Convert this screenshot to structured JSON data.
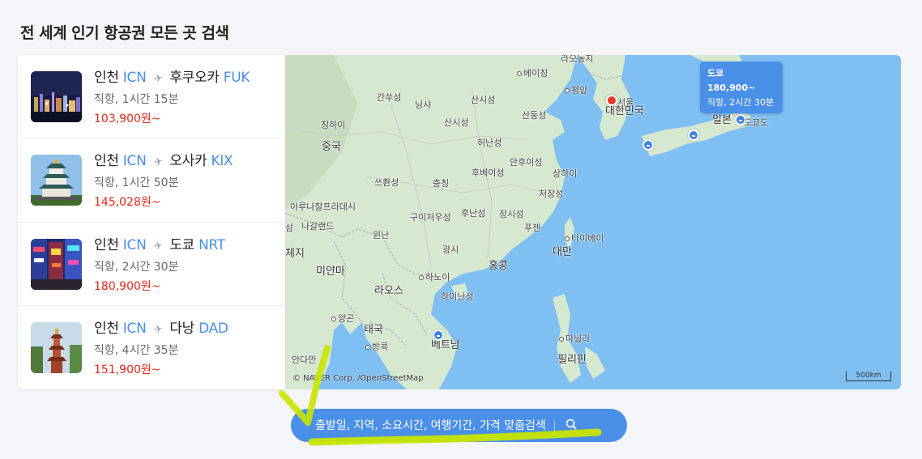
{
  "page_title": "전 세계 인기 항공권 모든 곳 검색",
  "flights": [
    {
      "origin": "인천",
      "origin_code": "ICN",
      "dest": "후쿠오카",
      "dest_code": "FUK",
      "meta": "직항, 1시간 15분",
      "price": "103,900원~",
      "thumb": "night-city"
    },
    {
      "origin": "인천",
      "origin_code": "ICN",
      "dest": "오사카",
      "dest_code": "KIX",
      "meta": "직항, 1시간 50분",
      "price": "145,028원~",
      "thumb": "castle"
    },
    {
      "origin": "인천",
      "origin_code": "ICN",
      "dest": "도쿄",
      "dest_code": "NRT",
      "meta": "직항, 2시간 30분",
      "price": "180,900원~",
      "thumb": "neon-street"
    },
    {
      "origin": "인천",
      "origin_code": "ICN",
      "dest": "다낭",
      "dest_code": "DAD",
      "meta": "직항, 4시간 35분",
      "price": "151,900원~",
      "thumb": "pagoda"
    }
  ],
  "map": {
    "tooltip": {
      "city": "도쿄",
      "price": "180,900~",
      "meta": "직항, 2시간 30분"
    },
    "labels": {
      "vladivostok": "라오동지",
      "beijing": "베이징",
      "pyongyang": "평양",
      "seoul": "서울",
      "korea": "대한민국",
      "japan": "일본",
      "tokyo": "도쿄도",
      "gansu": "간쑤성",
      "ningxia": "닝샤",
      "shanxi": "산시성",
      "shandong": "산둥성",
      "qinghai": "칭하이",
      "shaanxi": "산시성",
      "henan": "허난성",
      "china": "중국",
      "anhui": "안후이성",
      "hubei": "후베이성",
      "sichuan": "쓰촨성",
      "chongqing": "충칭",
      "shanghai": "상하이",
      "zhejiang": "저장성",
      "arunachal": "아루나찰프라데시",
      "nagaland": "나갈랜드",
      "guizhou": "구이저우성",
      "hunan": "후난성",
      "jiangxi": "장시성",
      "fujian": "푸젠",
      "taipei": "타이베이",
      "taiwan": "대만",
      "yunnan": "윈난",
      "guangxi": "광시",
      "hongkong": "홍콩",
      "myanmar": "미얀마",
      "hanoi": "하노이",
      "hainan": "하이난성",
      "laos": "라오스",
      "yangon": "양곤",
      "thailand": "태국",
      "bangkok": "방콕",
      "vietnam": "베트남",
      "manila": "마닐라",
      "philippines": "필리핀",
      "andaman": "안다만",
      "sam": "삼",
      "manipur": "체지"
    },
    "attribution": "© NAVER Corp. /OpenStreetMap",
    "scale": "500km"
  },
  "search": {
    "label": "출발일, 지역, 소요시간, 여행기간, 가격 맞춤검색"
  },
  "colors": {
    "accent": "#4a8fe8",
    "price": "#e0281b",
    "water": "#7fbff2",
    "land": "#d6e8d0",
    "highlighter": "#c8e600"
  }
}
